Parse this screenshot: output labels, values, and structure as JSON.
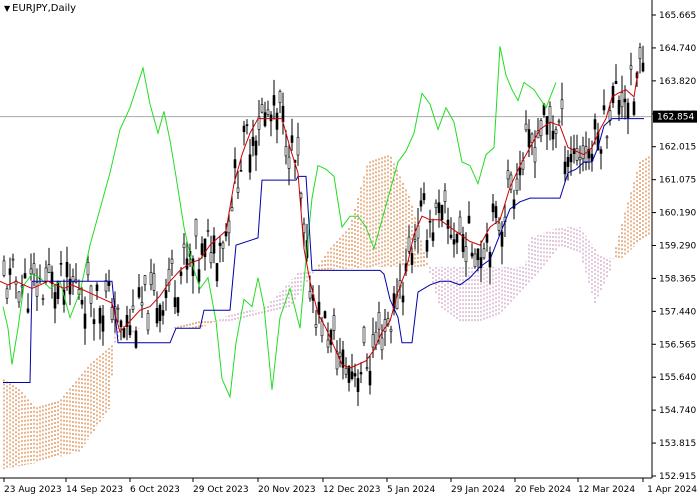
{
  "header": {
    "symbol_label": "EURJPY,Daily"
  },
  "chart_data": {
    "type": "candlestick",
    "title": "EURJPY,Daily",
    "ylim": [
      152.7,
      166.0
    ],
    "y_ticks": [
      "165.665",
      "164.740",
      "163.820",
      "162.895",
      "162.015",
      "161.075",
      "160.190",
      "159.290",
      "158.365",
      "157.440",
      "156.565",
      "155.640",
      "154.740",
      "153.815",
      "152.915"
    ],
    "x_ticks": [
      "23 Aug 2023",
      "14 Sep 2023",
      "6 Oct 2023",
      "29 Oct 2023",
      "20 Nov 2023",
      "12 Dec 2023",
      "5 Jan 2024",
      "29 Jan 2024",
      "20 Feb 2024",
      "12 Mar 2024",
      "1 Apr 2024"
    ],
    "current_price": "162.854",
    "grid": false,
    "colors": {
      "candles": "#000000",
      "tenkan": "#cc0000",
      "kijun": "#0000aa",
      "chikou": "#22dd22",
      "senkou_a": "#d2691e",
      "senkou_b": "#c48fb8",
      "price_line": "#a9a9a9",
      "price_label_bg": "#000000"
    },
    "series": [
      {
        "name": "Tenkan-sen",
        "points": [
          [
            0,
            158.3
          ],
          [
            8,
            158.2
          ],
          [
            16,
            158.3
          ],
          [
            24,
            158.2
          ],
          [
            32,
            158.1
          ],
          [
            40,
            158.2
          ],
          [
            48,
            158.3
          ],
          [
            56,
            158.2
          ],
          [
            64,
            158.1
          ],
          [
            72,
            158.2
          ],
          [
            80,
            158.1
          ],
          [
            88,
            158.0
          ],
          [
            96,
            157.9
          ],
          [
            104,
            157.8
          ],
          [
            112,
            157.7
          ],
          [
            120,
            156.9
          ],
          [
            130,
            157.2
          ],
          [
            140,
            157.5
          ],
          [
            150,
            157.6
          ],
          [
            160,
            157.9
          ],
          [
            170,
            158.3
          ],
          [
            180,
            158.6
          ],
          [
            190,
            158.8
          ],
          [
            200,
            158.9
          ],
          [
            210,
            159.3
          ],
          [
            218,
            159.5
          ],
          [
            226,
            159.7
          ],
          [
            234,
            161.0
          ],
          [
            242,
            161.8
          ],
          [
            250,
            162.4
          ],
          [
            258,
            162.8
          ],
          [
            266,
            162.8
          ],
          [
            274,
            162.8
          ],
          [
            282,
            162.8
          ],
          [
            290,
            162.0
          ],
          [
            298,
            161.3
          ],
          [
            304,
            159.2
          ],
          [
            310,
            158.3
          ],
          [
            318,
            157.4
          ],
          [
            326,
            157.0
          ],
          [
            334,
            156.5
          ],
          [
            342,
            156.0
          ],
          [
            350,
            155.9
          ],
          [
            358,
            156.0
          ],
          [
            366,
            156.1
          ],
          [
            374,
            156.4
          ],
          [
            382,
            156.9
          ],
          [
            390,
            157.2
          ],
          [
            398,
            158.0
          ],
          [
            406,
            158.6
          ],
          [
            414,
            159.6
          ],
          [
            422,
            160.1
          ],
          [
            430,
            160.0
          ],
          [
            440,
            160.0
          ],
          [
            450,
            159.8
          ],
          [
            460,
            159.6
          ],
          [
            470,
            159.4
          ],
          [
            480,
            159.3
          ],
          [
            490,
            159.8
          ],
          [
            500,
            160.0
          ],
          [
            510,
            160.9
          ],
          [
            520,
            161.5
          ],
          [
            530,
            162.0
          ],
          [
            540,
            162.5
          ],
          [
            550,
            162.7
          ],
          [
            560,
            162.6
          ],
          [
            568,
            162.0
          ],
          [
            576,
            161.9
          ],
          [
            584,
            161.8
          ],
          [
            592,
            162.0
          ],
          [
            600,
            162.5
          ],
          [
            606,
            162.8
          ],
          [
            612,
            163.4
          ],
          [
            618,
            163.5
          ],
          [
            626,
            163.6
          ],
          [
            634,
            163.4
          ],
          [
            638,
            164.1
          ]
        ]
      },
      {
        "name": "Kijun-sen",
        "points": [
          [
            3,
            155.5
          ],
          [
            30,
            155.5
          ],
          [
            32,
            158.3
          ],
          [
            112,
            158.3
          ],
          [
            118,
            156.6
          ],
          [
            170,
            156.6
          ],
          [
            176,
            157.0
          ],
          [
            200,
            157.0
          ],
          [
            204,
            157.5
          ],
          [
            230,
            157.5
          ],
          [
            236,
            159.3
          ],
          [
            258,
            159.5
          ],
          [
            262,
            161.1
          ],
          [
            296,
            161.1
          ],
          [
            298,
            161.2
          ],
          [
            306,
            161.2
          ],
          [
            312,
            158.6
          ],
          [
            380,
            158.6
          ],
          [
            384,
            158.5
          ],
          [
            390,
            157.8
          ],
          [
            398,
            157.3
          ],
          [
            402,
            156.6
          ],
          [
            412,
            156.6
          ],
          [
            418,
            158.0
          ],
          [
            430,
            158.2
          ],
          [
            440,
            158.3
          ],
          [
            450,
            158.3
          ],
          [
            460,
            158.2
          ],
          [
            470,
            158.4
          ],
          [
            480,
            158.7
          ],
          [
            490,
            158.9
          ],
          [
            500,
            159.6
          ],
          [
            510,
            160.3
          ],
          [
            520,
            160.5
          ],
          [
            530,
            160.6
          ],
          [
            540,
            160.6
          ],
          [
            560,
            160.6
          ],
          [
            568,
            161.3
          ],
          [
            576,
            161.4
          ],
          [
            584,
            161.6
          ],
          [
            592,
            161.6
          ],
          [
            598,
            162.0
          ],
          [
            604,
            162.6
          ],
          [
            612,
            162.8
          ],
          [
            644,
            162.8
          ]
        ]
      },
      {
        "name": "Chikou",
        "points": [
          [
            3,
            157.6
          ],
          [
            8,
            157.0
          ],
          [
            12,
            156.0
          ],
          [
            18,
            157.0
          ],
          [
            24,
            158.2
          ],
          [
            32,
            158.5
          ],
          [
            40,
            158.4
          ],
          [
            50,
            158.1
          ],
          [
            60,
            158.3
          ],
          [
            70,
            157.3
          ],
          [
            80,
            158.0
          ],
          [
            90,
            159.3
          ],
          [
            100,
            160.3
          ],
          [
            110,
            161.3
          ],
          [
            120,
            162.5
          ],
          [
            130,
            163.1
          ],
          [
            143,
            164.2
          ],
          [
            150,
            163.2
          ],
          [
            158,
            162.4
          ],
          [
            164,
            163.0
          ],
          [
            170,
            162.2
          ],
          [
            176,
            161.2
          ],
          [
            184,
            159.8
          ],
          [
            192,
            158.8
          ],
          [
            200,
            158.1
          ],
          [
            208,
            158.4
          ],
          [
            216,
            157.2
          ],
          [
            222,
            155.6
          ],
          [
            230,
            155.1
          ],
          [
            236,
            156.6
          ],
          [
            244,
            157.8
          ],
          [
            252,
            157.6
          ],
          [
            258,
            158.4
          ],
          [
            264,
            157.6
          ],
          [
            272,
            155.3
          ],
          [
            280,
            157.3
          ],
          [
            290,
            158.1
          ],
          [
            300,
            157.0
          ],
          [
            306,
            158.9
          ],
          [
            312,
            160.6
          ],
          [
            318,
            161.5
          ],
          [
            326,
            161.4
          ],
          [
            334,
            161.2
          ],
          [
            342,
            159.8
          ],
          [
            350,
            160.1
          ],
          [
            358,
            160.1
          ],
          [
            366,
            159.8
          ],
          [
            374,
            159.2
          ],
          [
            382,
            160.0
          ],
          [
            390,
            160.8
          ],
          [
            398,
            161.6
          ],
          [
            406,
            161.9
          ],
          [
            414,
            162.4
          ],
          [
            422,
            163.5
          ],
          [
            430,
            163.2
          ],
          [
            438,
            162.5
          ],
          [
            446,
            163.1
          ],
          [
            454,
            162.7
          ],
          [
            462,
            161.6
          ],
          [
            470,
            161.5
          ],
          [
            478,
            161.0
          ],
          [
            486,
            161.8
          ],
          [
            494,
            162.0
          ],
          [
            500,
            164.8
          ],
          [
            506,
            164.0
          ],
          [
            512,
            163.6
          ],
          [
            518,
            163.3
          ],
          [
            524,
            163.8
          ],
          [
            534,
            163.6
          ],
          [
            546,
            163.1
          ],
          [
            556,
            163.8
          ]
        ]
      },
      {
        "name": "Senkou A",
        "points": [
          [
            3,
            155.6
          ],
          [
            20,
            155.3
          ],
          [
            35,
            154.8
          ],
          [
            60,
            155.0
          ],
          [
            90,
            156.0
          ],
          [
            115,
            156.6
          ],
          [
            140,
            157.0
          ],
          [
            170,
            157.0
          ],
          [
            200,
            157.2
          ],
          [
            230,
            157.2
          ],
          [
            260,
            157.4
          ],
          [
            290,
            157.6
          ],
          [
            310,
            158.4
          ],
          [
            330,
            159.2
          ],
          [
            350,
            159.8
          ],
          [
            368,
            161.6
          ],
          [
            390,
            161.8
          ],
          [
            410,
            160.6
          ],
          [
            425,
            159.0
          ],
          [
            440,
            157.6
          ],
          [
            460,
            157.2
          ],
          [
            480,
            157.2
          ],
          [
            500,
            157.4
          ],
          [
            520,
            158.0
          ],
          [
            540,
            158.6
          ],
          [
            560,
            159.3
          ],
          [
            580,
            159.1
          ],
          [
            595,
            157.7
          ],
          [
            610,
            158.6
          ],
          [
            625,
            160.2
          ],
          [
            640,
            161.6
          ],
          [
            652,
            161.8
          ]
        ]
      },
      {
        "name": "Senkou B",
        "points": [
          [
            3,
            153.1
          ],
          [
            40,
            153.3
          ],
          [
            80,
            153.6
          ],
          [
            110,
            154.8
          ],
          [
            115,
            157.0
          ],
          [
            170,
            157.0
          ],
          [
            200,
            157.0
          ],
          [
            240,
            157.5
          ],
          [
            262,
            157.5
          ],
          [
            280,
            158.0
          ],
          [
            300,
            158.6
          ],
          [
            315,
            158.6
          ],
          [
            380,
            158.7
          ],
          [
            440,
            158.7
          ],
          [
            470,
            158.7
          ],
          [
            500,
            158.7
          ],
          [
            525,
            158.7
          ],
          [
            530,
            159.5
          ],
          [
            560,
            159.8
          ],
          [
            580,
            159.8
          ],
          [
            600,
            159.0
          ],
          [
            620,
            158.9
          ],
          [
            640,
            159.4
          ],
          [
            652,
            159.6
          ]
        ]
      }
    ]
  }
}
